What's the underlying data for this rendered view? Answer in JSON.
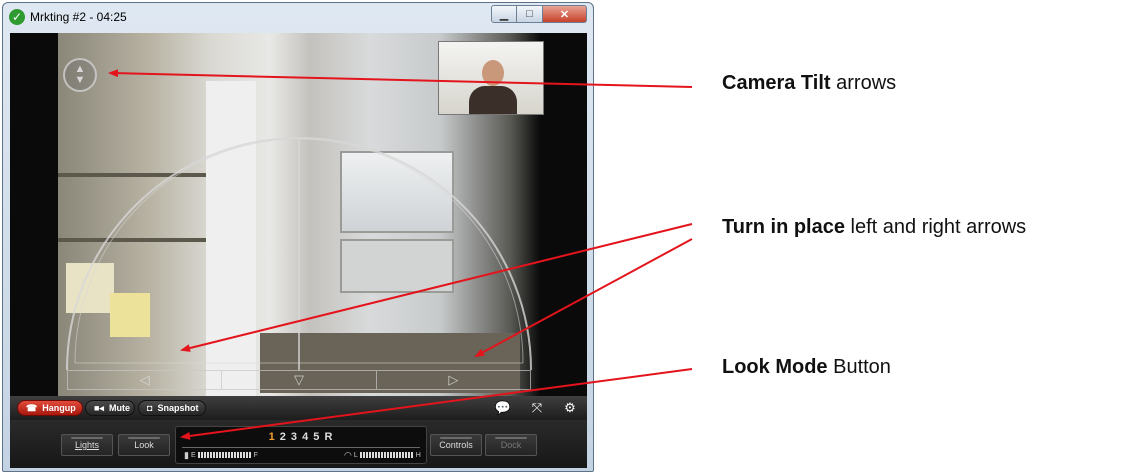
{
  "window": {
    "title": "Mrkting #2 - 04:25",
    "minimize_glyph": "▁",
    "maximize_glyph": "□",
    "close_glyph": "✕"
  },
  "video": {
    "tilt_up_glyph": "▲",
    "tilt_down_glyph": "▼",
    "drive": {
      "left": "◁",
      "back": "▽",
      "right": "▷"
    }
  },
  "toolbar": {
    "hangup": "Hangup",
    "mute": "Mute",
    "snapshot": "Snapshot",
    "chat_glyph": "💬",
    "fullscreen_glyph": "⤧",
    "settings_glyph": "⚙"
  },
  "panel": {
    "lights": "Lights",
    "look": "Look",
    "controls": "Controls",
    "dock": "Dock",
    "speed_active": "1",
    "speed_rest": " 2 3 4 5 R",
    "battery_left": "E",
    "battery_right": "F",
    "wifi_left": "L",
    "wifi_right": "H"
  },
  "annotations": {
    "tilt_bold": "Camera Tilt",
    "tilt_rest": " arrows",
    "turn_bold": "Turn in place",
    "turn_rest": " left and right arrows",
    "look_bold": "Look Mode",
    "look_rest": " Button"
  },
  "colors": {
    "arrow": "#e3141b",
    "hangup": "#c8281a",
    "speed_active": "#f0a030"
  }
}
